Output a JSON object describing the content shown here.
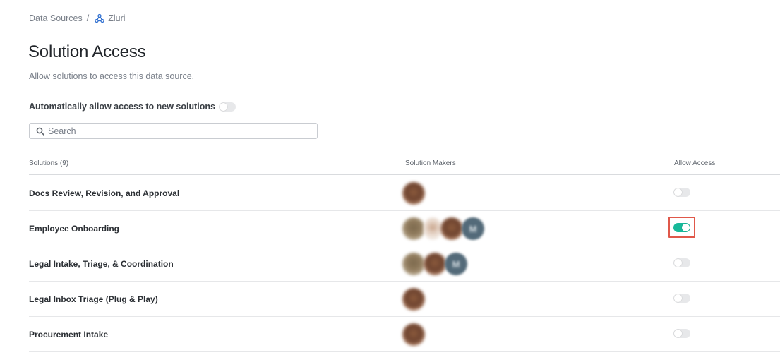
{
  "breadcrumb": {
    "parent": "Data Sources",
    "separator": "/",
    "current": "Zluri",
    "current_icon": "webhook-icon"
  },
  "page": {
    "title": "Solution Access",
    "subtitle": "Allow solutions to access this data source."
  },
  "auto_access": {
    "label": "Automatically allow access to new solutions",
    "enabled": false
  },
  "search": {
    "placeholder": "Search",
    "value": "",
    "icon": "search-icon"
  },
  "table": {
    "headers": {
      "solutions": "Solutions (9)",
      "makers": "Solution Makers",
      "access": "Allow Access"
    },
    "rows": [
      {
        "name": "Docs Review, Revision, and Approval",
        "makers": [
          "brown"
        ],
        "allow_access": false,
        "highlighted": false
      },
      {
        "name": "Employee Onboarding",
        "makers": [
          "olive",
          "light",
          "brown",
          "slate"
        ],
        "allow_access": true,
        "highlighted": true
      },
      {
        "name": "Legal Intake, Triage, & Coordination",
        "makers": [
          "olive",
          "brown",
          "slate"
        ],
        "allow_access": false,
        "highlighted": false
      },
      {
        "name": "Legal Inbox Triage (Plug & Play)",
        "makers": [
          "brown"
        ],
        "allow_access": false,
        "highlighted": false
      },
      {
        "name": "Procurement Intake",
        "makers": [
          "brown"
        ],
        "allow_access": false,
        "highlighted": false
      }
    ]
  },
  "avatar_initial": "M",
  "colors": {
    "toggle_on": "#18b99a",
    "toggle_off": "#e7e8ea",
    "highlight_border": "#e0584a",
    "icon_blue": "#2f6fd0"
  }
}
